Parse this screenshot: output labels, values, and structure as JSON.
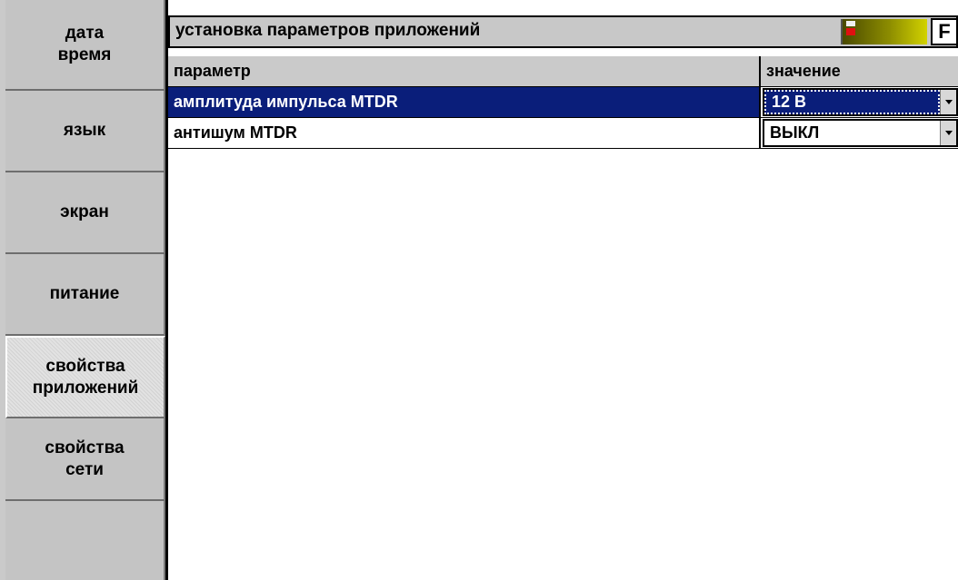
{
  "sidebar": {
    "items": [
      {
        "label": "дата\nвремя",
        "active": false
      },
      {
        "label": "язык",
        "active": false
      },
      {
        "label": "экран",
        "active": false
      },
      {
        "label": "питание",
        "active": false
      },
      {
        "label": "свойства\nприложений",
        "active": true
      },
      {
        "label": "свойства\nсети",
        "active": false
      }
    ]
  },
  "header": {
    "title": "установка параметров приложений",
    "f_button": "F"
  },
  "table": {
    "columns": [
      "параметр",
      "значение"
    ],
    "rows": [
      {
        "param": "амплитуда импульса MTDR",
        "value": "12 В"
      },
      {
        "param": "антишум MTDR",
        "value": "ВЫКЛ"
      }
    ]
  },
  "colors": {
    "selection": "#0a1e7a",
    "indicator": "#d2d200",
    "indicator_alarm": "#e01010"
  }
}
